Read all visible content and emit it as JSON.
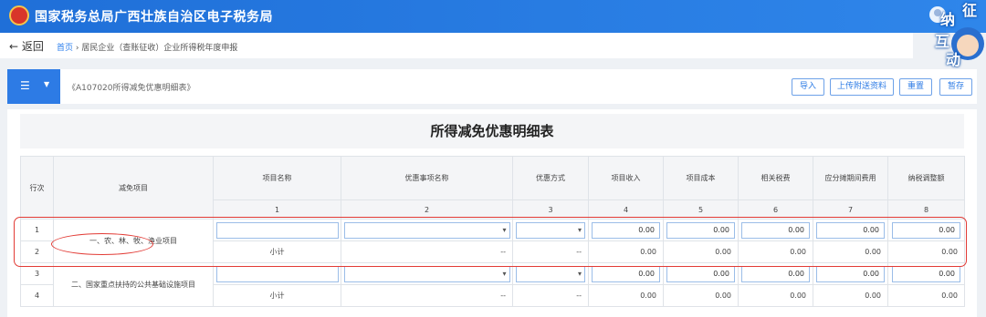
{
  "header": {
    "site_title": "国家税务总局广西壮族自治区电子税务局",
    "mascot_chars": [
      "纳",
      "征",
      "互",
      "动"
    ]
  },
  "nav": {
    "back_label": "返回",
    "breadcrumb": {
      "home": "首页",
      "separator": "›",
      "current": "居民企业（查账征收）企业所得税年度申报"
    }
  },
  "toolbar": {
    "menu_icon": "☰",
    "form_name": "《A107020所得减免优惠明细表》",
    "buttons": [
      "导入",
      "上传附送资料",
      "重置",
      "暂存"
    ]
  },
  "table": {
    "title": "所得减免优惠明细表",
    "headers": [
      "行次",
      "减免项目",
      "项目名称",
      "优惠事项名称",
      "优惠方式",
      "项目收入",
      "项目成本",
      "相关税费",
      "应分摊期间费用",
      "纳税调整额"
    ],
    "col_numbers": [
      "1",
      "2",
      "3",
      "4",
      "5",
      "6",
      "7",
      "8"
    ],
    "groups": [
      {
        "category": "一、农、林、牧、渔业项目",
        "rows": [
          {
            "line": "1",
            "values": [
              "0.00",
              "0.00",
              "0.00",
              "0.00",
              "0.00"
            ]
          },
          {
            "line": "2",
            "subtotal": "小计",
            "dash": "--",
            "values": [
              "0.00",
              "0.00",
              "0.00",
              "0.00",
              "0.00"
            ]
          }
        ]
      },
      {
        "category": "二、国家重点扶持的公共基础设施项目",
        "rows": [
          {
            "line": "3",
            "values": [
              "0.00",
              "0.00",
              "0.00",
              "0.00",
              "0.00"
            ]
          },
          {
            "line": "4",
            "subtotal": "小计",
            "dash": "--",
            "values": [
              "0.00",
              "0.00",
              "0.00",
              "0.00",
              "0.00"
            ]
          }
        ]
      }
    ]
  },
  "colors": {
    "primary": "#2d7be5",
    "highlight": "#e23b35"
  }
}
